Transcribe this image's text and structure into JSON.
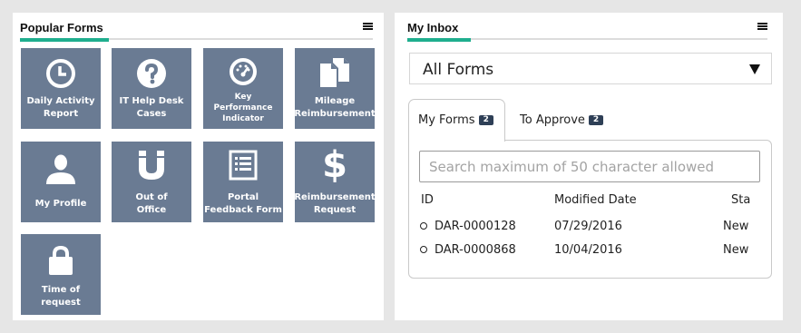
{
  "popular_forms": {
    "title": "Popular Forms",
    "tiles": [
      {
        "label": "Daily Activity\nReport",
        "icon": "clock-icon"
      },
      {
        "label": "IT Help Desk\nCases",
        "icon": "question-icon"
      },
      {
        "label": "Key\nPerformance\nIndicator",
        "icon": "gauge-icon"
      },
      {
        "label": "Mileage\nReimbursement",
        "icon": "documents-icon"
      },
      {
        "label": "My Profile",
        "icon": "person-icon"
      },
      {
        "label": "Out of\nOffice",
        "icon": "magnet-icon"
      },
      {
        "label": "Portal\nFeedback Form",
        "icon": "form-list-icon"
      },
      {
        "label": "Reimbursement\nRequest",
        "icon": "dollar-icon"
      },
      {
        "label": "Time of\nrequest",
        "icon": "lock-icon"
      }
    ]
  },
  "inbox": {
    "title": "My Inbox",
    "filter_selected": "All Forms",
    "tabs": [
      {
        "label": "My Forms",
        "count": "2"
      },
      {
        "label": "To Approve",
        "count": "2"
      }
    ],
    "search_placeholder": "Search maximum of 50 character allowed",
    "columns": [
      "ID",
      "Modified Date",
      "Sta"
    ],
    "rows": [
      {
        "id": "DAR-0000128",
        "modified": "07/29/2016",
        "status": "New"
      },
      {
        "id": "DAR-0000868",
        "modified": "10/04/2016",
        "status": "New"
      }
    ]
  },
  "colors": {
    "tile_bg": "#6a7b93",
    "accent": "#1fae8e",
    "badge_bg": "#2e3f56",
    "page_bg": "#e6e6e6"
  }
}
